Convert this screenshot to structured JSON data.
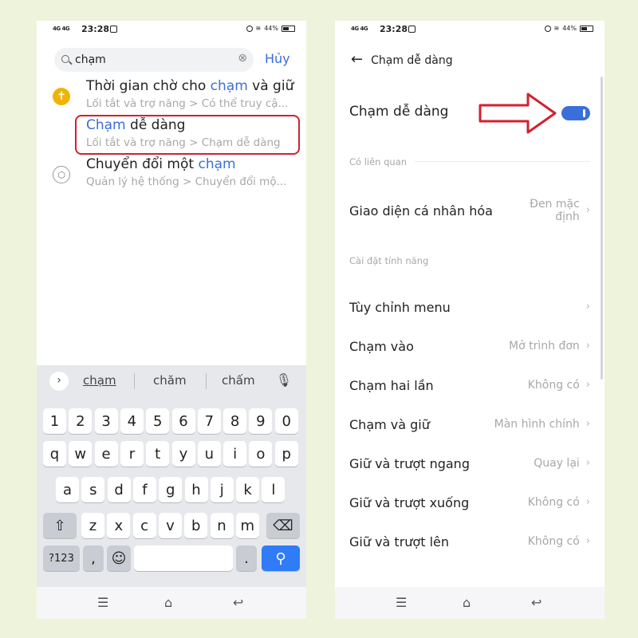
{
  "status_bar": {
    "signal": "4G 4G",
    "time": "23:28",
    "battery": "44%"
  },
  "left": {
    "search": {
      "value": "chạm",
      "cancel_label": "Hủy"
    },
    "results": [
      {
        "title_parts": [
          "Thời gian chờ cho ",
          "chạm",
          " và giữ"
        ],
        "path": "Lối tắt và trợ năng > Có thể truy cậ..."
      },
      {
        "title_parts": [
          "",
          "Chạm",
          " dễ dàng"
        ],
        "path": "Lối tắt và trợ năng > Chạm dễ dàng"
      },
      {
        "title_parts": [
          "Chuyển đổi một ",
          "chạm",
          ""
        ],
        "path": "Quản lý hệ thống > Chuyển đổi mộ..."
      }
    ],
    "keyboard": {
      "suggestions": [
        "chạm",
        "chăm",
        "chấm"
      ],
      "row_numbers": [
        "1",
        "2",
        "3",
        "4",
        "5",
        "6",
        "7",
        "8",
        "9",
        "0"
      ],
      "row_top": [
        "q",
        "w",
        "e",
        "r",
        "t",
        "y",
        "u",
        "i",
        "o",
        "p"
      ],
      "row_mid": [
        "a",
        "s",
        "d",
        "f",
        "g",
        "h",
        "j",
        "k",
        "l"
      ],
      "row_bottom": [
        "z",
        "x",
        "c",
        "v",
        "b",
        "n",
        "m"
      ],
      "sym_label": "?123",
      "comma_label": ",",
      "period_label": "."
    }
  },
  "right": {
    "header_title": "Chạm dễ dàng",
    "main_toggle": {
      "label": "Chạm dễ dàng",
      "on": true
    },
    "section_related": "Có liên quan",
    "theme_row": {
      "label": "Giao diện cá nhân hóa",
      "value_line1": "Đen mặc",
      "value_line2": "định"
    },
    "section_features": "Cài đặt tính năng",
    "rows": [
      {
        "label": "Tùy chỉnh menu",
        "value": ""
      },
      {
        "label": "Chạm vào",
        "value": "Mở trình đơn"
      },
      {
        "label": "Chạm hai lần",
        "value": "Không có"
      },
      {
        "label": "Chạm và giữ",
        "value": "Màn hình chính"
      },
      {
        "label": "Giữ và trượt ngang",
        "value": "Quay lại"
      },
      {
        "label": "Giữ và trượt xuống",
        "value": "Không có"
      },
      {
        "label": "Giữ và trượt lên",
        "value": "Không có"
      }
    ]
  },
  "colors": {
    "accent": "#3a6fd9",
    "highlight": "#d0212f",
    "background": "#eef4dc"
  }
}
